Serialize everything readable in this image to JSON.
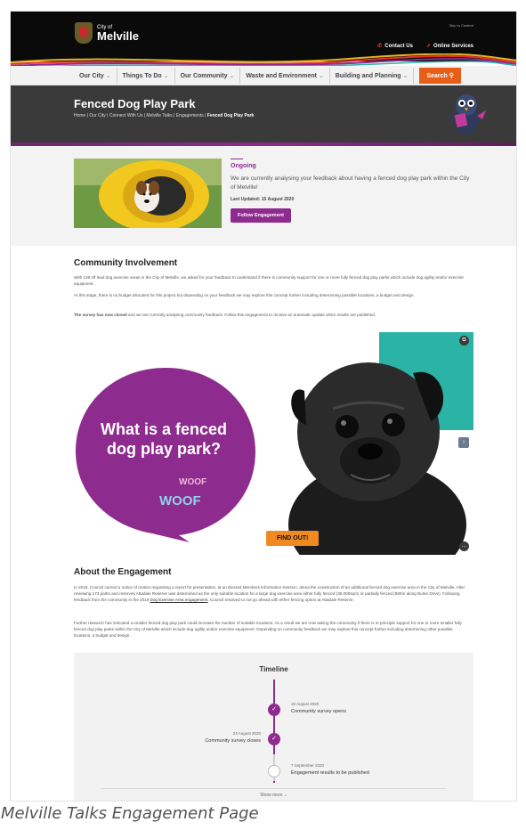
{
  "header": {
    "logo_small": "City of",
    "logo_big": "Melville",
    "skip_link": "Skip to Content",
    "contact_label": "Contact Us",
    "online_services_label": "Online Services"
  },
  "nav": {
    "items": [
      {
        "label": "Our City",
        "caret": "⌄"
      },
      {
        "label": "Things To Do",
        "caret": "⌄"
      },
      {
        "label": "Our Community",
        "caret": "⌄"
      },
      {
        "label": "Waste and Environment",
        "caret": "⌄"
      },
      {
        "label": "Building and Planning",
        "caret": "⌄"
      }
    ],
    "search_label": "Search"
  },
  "banner": {
    "title": "Fenced Dog Play Park",
    "breadcrumb": "Home  |  Our City  |  Connect With Us  |  Melville Talks  |  Engagements  |",
    "breadcrumb_current": "Fenced Dog Play Park"
  },
  "hero": {
    "status": "Ongoing",
    "description": "We are currently analysing your feedback about having a fenced dog play park within the City of Melville!",
    "updated": "Last Updated: 15 August 2020",
    "follow_label": "Follow Engagement"
  },
  "community": {
    "heading": "Community Involvement",
    "para1": "With 138 off lead dog exercise areas in the City of Melville, we asked for your feedback to understand if there is community support for one or more fully fenced dog play parks which include dog agility and/or exercise equipment.",
    "para2": "At this stage, there is no budget allocated for this project but depending on your feedback we may explore this concept further including determining possible locations, a budget and design.",
    "para3_bold": "The survey has now closed",
    "para3_rest": " and we are currently analysing community feedback. Follow this engagement to receive an automatic update when results are published."
  },
  "promo": {
    "headline": "What is a fenced dog play park?",
    "woof_small": "WOOF",
    "woof_big": "WOOF",
    "find_out_label": "FIND OUT!",
    "colors": {
      "purple": "#8e2b8e",
      "teal": "#2bb3a6",
      "orange": "#f08a20"
    }
  },
  "about": {
    "heading": "About the Engagement",
    "para1": "In 2018, Council carried a notice of motion requesting a report for presentation, at an Elected Members Information Session, about the construction of an additional fenced dog exercise area in the City of Melville. After reviewing 173 parks and reserves Attadale Reserve was determined as the only suitable location for a large dog exercise area either fully fenced (35,000sqm) or partially fenced (980m along Burke Drive). Following feedback from the community in the 2019",
    "para1_link": "Dog Exercise Area engagement",
    "para1_end": ", Council resolved to not go ahead with either fencing option at Attadale Reserve.",
    "para2": "Further research has indicated a smaller fenced dog play park could increase the number of suitable locations. As a result we are now asking the community if there is in-principle support for one or more smaller fully fenced dog play parks within the City of Melville which include dog agility and/or exercise equipment. Depending on community feedback we may explore this concept further including determining other possible locations, a budget and design."
  },
  "timeline": {
    "title": "Timeline",
    "events": [
      {
        "date": "10 August 2020",
        "label": "Community survey opens",
        "done": true
      },
      {
        "date": "24 August 2020",
        "label": "Community survey closes",
        "done": true
      },
      {
        "date": "7 September 2020",
        "label": "Engagement results to be published",
        "done": false
      }
    ],
    "show_more": "Show more ⌄"
  },
  "caption": "Melville Talks Engagement Page"
}
